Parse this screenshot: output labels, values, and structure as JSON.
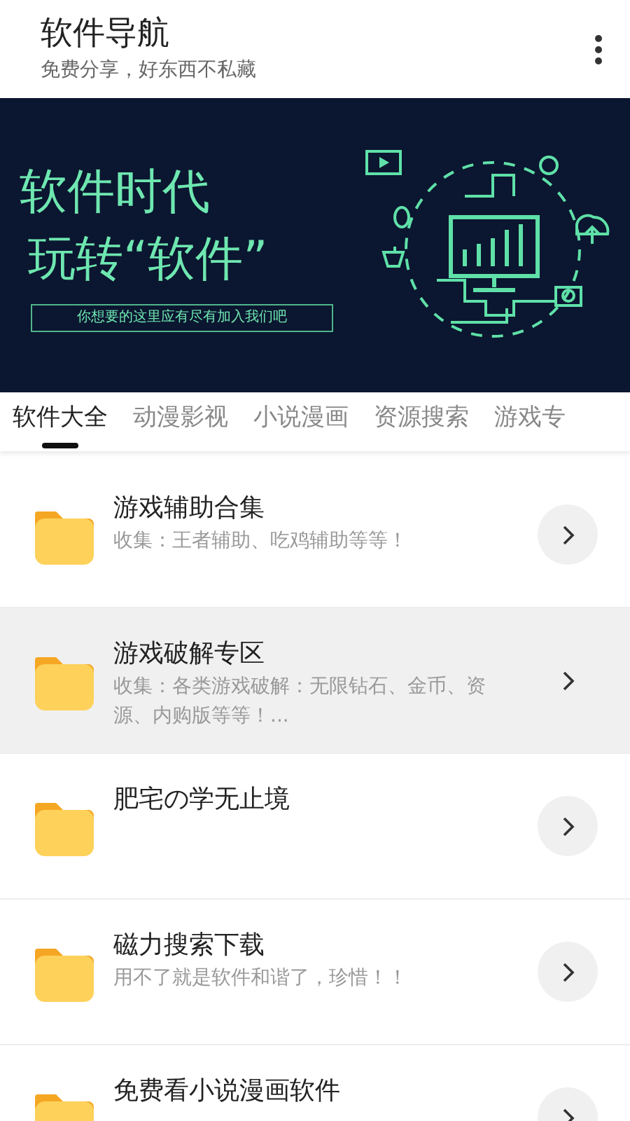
{
  "header": {
    "title": "软件导航",
    "subtitle": "免费分享，好东西不私藏"
  },
  "banner": {
    "headline_1": "软件时代",
    "headline_2": "玩转“软件”",
    "tagline": "你想要的这里应有尽有加入我们吧"
  },
  "tabs": [
    {
      "label": "软件大全",
      "selected": true
    },
    {
      "label": "动漫影视",
      "selected": false
    },
    {
      "label": "小说漫画",
      "selected": false
    },
    {
      "label": "资源搜索",
      "selected": false
    },
    {
      "label": "游戏专",
      "selected": false
    }
  ],
  "items": [
    {
      "title": "游戏辅助合集",
      "description": "收集：王者辅助、吃鸡辅助等等！",
      "selected": false
    },
    {
      "title": "游戏破解专区",
      "description": "收集：各类游戏破解：无限钻石、金币、资源、内购版等等！...",
      "selected": true
    },
    {
      "title": "肥宅の学无止境",
      "selected": false
    },
    {
      "title": "磁力搜索下载",
      "description": "用不了就是软件和谐了，珍惜！！",
      "selected": false
    },
    {
      "title": "免费看小说漫画软件",
      "selected": false
    }
  ]
}
